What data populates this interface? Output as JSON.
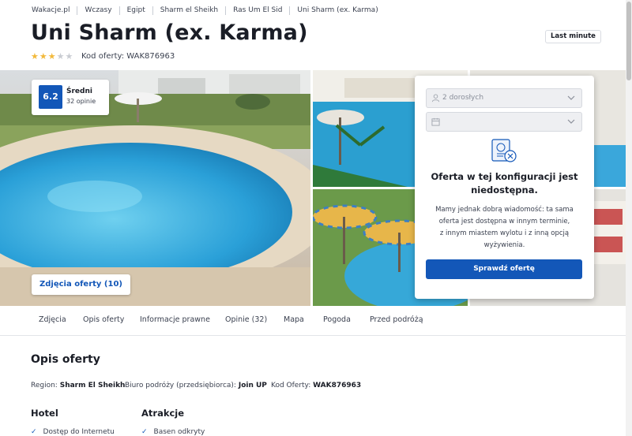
{
  "breadcrumb": [
    "Wakacje.pl",
    "Wczasy",
    "Egipt",
    "Sharm el Sheikh",
    "Ras Um El Sid",
    "Uni Sharm (ex. Karma)"
  ],
  "hotel": {
    "name": "Uni Sharm (ex. Karma)",
    "badge": "Last minute",
    "stars_filled": 3,
    "stars_total": 5,
    "code_text": "Kod oferty: WAK876963"
  },
  "rating": {
    "score": "6.2",
    "label": "Średni",
    "count": "32 opinie"
  },
  "gallery": {
    "photos_button": "Zdjęcia oferty (10)"
  },
  "booking": {
    "people_value": "2 dorosłych",
    "date_value": "",
    "title": "Oferta w tej konfiguracji jest niedostępna.",
    "lines": [
      "Mamy jednak dobrą wiadomość: ta sama",
      "oferta jest dostępna w innym terminie,",
      "z innym miastem wylotu i z inną opcją",
      "wyżywienia."
    ],
    "button": "Sprawdź ofertę"
  },
  "tabs": [
    "Zdjęcia",
    "Opis oferty",
    "Informacje prawne",
    "Opinie (32)",
    "Mapa",
    "Pogoda",
    "Przed podróżą"
  ],
  "description": {
    "title": "Opis oferty",
    "region_label": "Region:",
    "region_value": "Sharm El Sheikh",
    "organizer_label": "Biuro podróży (przedsiębiorca):",
    "organizer_value": "Join UP",
    "code_label": "Kod Oferty:",
    "code_value": "WAK876963",
    "hotel_heading": "Hotel",
    "hotel_features": [
      "Dostęp do Internetu"
    ],
    "attractions_heading": "Atrakcje",
    "attractions": [
      "Basen odkryty"
    ]
  },
  "colors": {
    "accent": "#1357b8",
    "star": "#f2b93b"
  }
}
